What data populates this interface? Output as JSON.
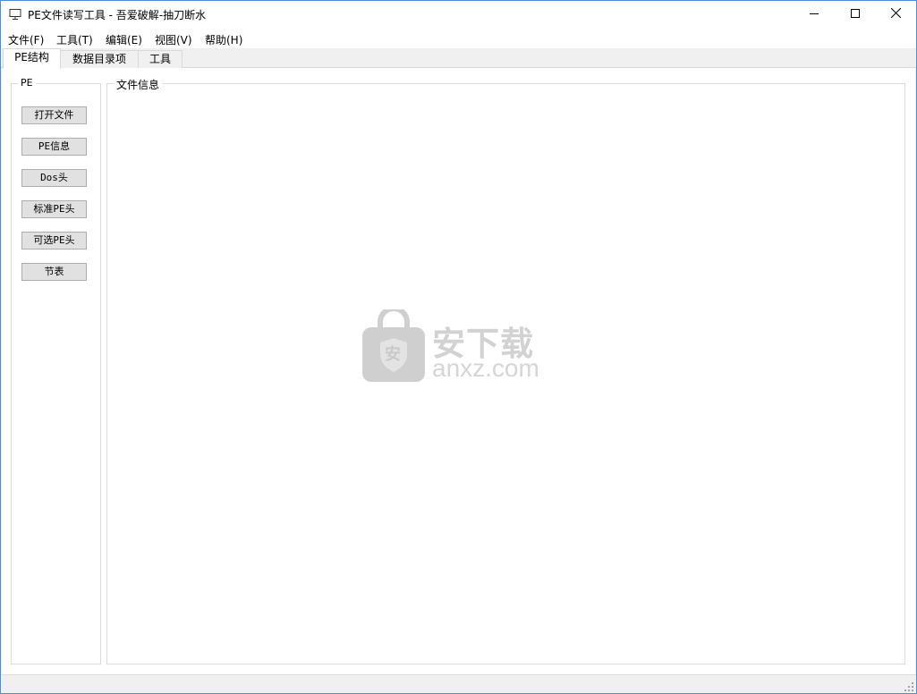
{
  "window": {
    "title": "PE文件读写工具 - 吾爱破解-抽刀断水"
  },
  "titlebar_icons": {
    "app": "computer-monitor-icon",
    "minimize": "minimize-icon",
    "maximize": "maximize-icon",
    "close": "close-icon"
  },
  "menu": {
    "items": [
      {
        "label": "文件(F)"
      },
      {
        "label": "工具(T)"
      },
      {
        "label": "编辑(E)"
      },
      {
        "label": "视图(V)"
      },
      {
        "label": "帮助(H)"
      }
    ]
  },
  "tabs": [
    {
      "label": "PE结构",
      "active": true
    },
    {
      "label": "数据目录项",
      "active": false
    },
    {
      "label": "工具",
      "active": false
    }
  ],
  "pe_group": {
    "legend": "PE",
    "buttons": [
      {
        "label": "打开文件"
      },
      {
        "label": "PE信息"
      },
      {
        "label": "Dos头"
      },
      {
        "label": "标准PE头"
      },
      {
        "label": "可选PE头"
      },
      {
        "label": "节表"
      }
    ]
  },
  "file_info_group": {
    "legend": "文件信息"
  },
  "watermark": {
    "cn_text": "安下载",
    "url": "anxz.com",
    "icon": "shield-lock-icon",
    "badge_char": "安"
  },
  "colors": {
    "window_border": "#4a90d9",
    "button_bg": "#e1e1e1",
    "button_border": "#adadad",
    "watermark": "#d2d2d2"
  }
}
